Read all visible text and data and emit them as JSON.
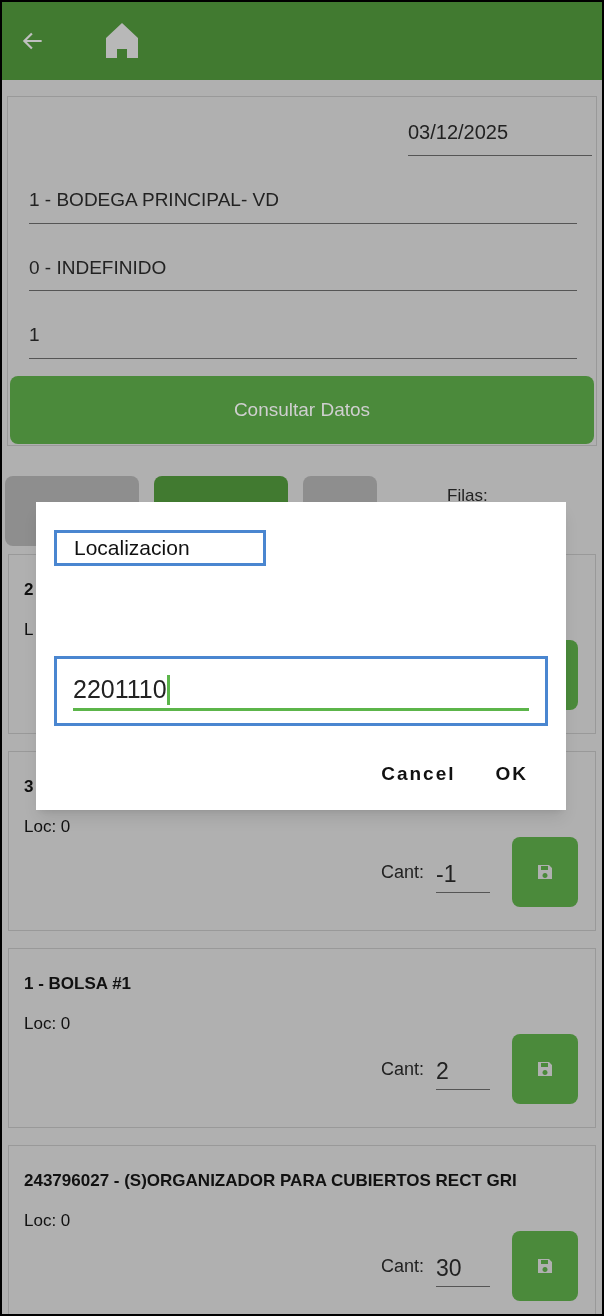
{
  "form": {
    "date": "03/12/2025",
    "fields": [
      "1 - BODEGA PRINCIPAL- VD",
      "0 - INDEFINIDO",
      "1"
    ],
    "button": "Consultar Datos"
  },
  "filter_tabs": [
    {
      "selected": false
    },
    {
      "selected": true
    },
    {
      "selected": false
    }
  ],
  "rows_label": "Filas:",
  "items": [
    {
      "title": "2",
      "loc": "L"
    },
    {
      "title": "3",
      "loc": "Loc: 0",
      "cant_label": "Cant:",
      "cant": "-1"
    },
    {
      "title": "1 - BOLSA #1",
      "loc": "Loc: 0",
      "cant_label": "Cant:",
      "cant": "2"
    },
    {
      "title": "243796027 - (S)ORGANIZADOR PARA CUBIERTOS RECT GRI",
      "loc": "Loc: 0",
      "cant_label": "Cant:",
      "cant": "30"
    }
  ],
  "dialog": {
    "title": "Localizacion",
    "value": "2201110",
    "buttons": [
      "Cancel",
      "OK"
    ]
  }
}
